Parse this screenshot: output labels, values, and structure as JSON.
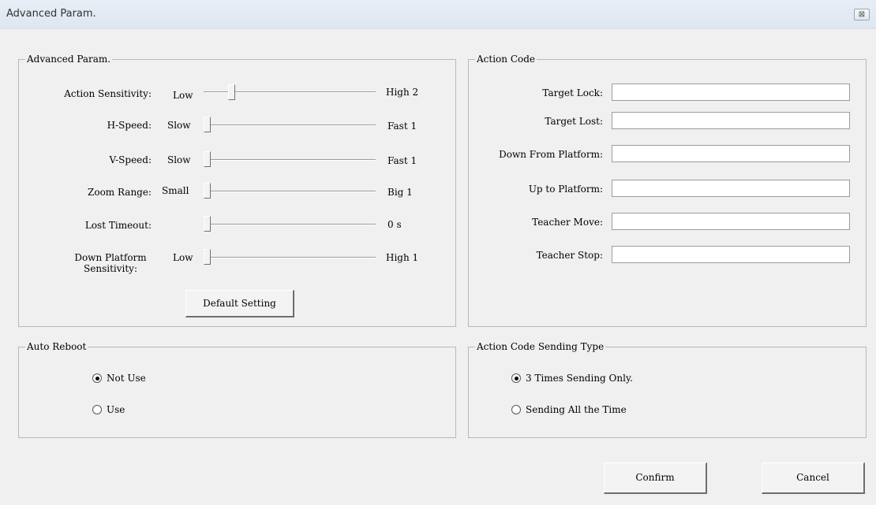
{
  "window": {
    "title": "Advanced Param.",
    "close_glyph": "⊠",
    "close_icon": "close-icon"
  },
  "advanced": {
    "legend": "Advanced Param.",
    "sliders": [
      {
        "label": "Action Sensitivity:",
        "low": "Low",
        "high": "High 2",
        "level": 0.15
      },
      {
        "label": "H-Speed:",
        "low": "Slow",
        "high": "Fast 1",
        "level": 0.0
      },
      {
        "label": "V-Speed:",
        "low": "Slow",
        "high": "Fast 1",
        "level": 0.0
      },
      {
        "label": "Zoom Range:",
        "low": "Small",
        "high": "Big 1",
        "level": 0.0
      },
      {
        "label": "Lost Timeout:",
        "low": "",
        "high": "0 s",
        "level": 0.0
      },
      {
        "label": "Down Platform Sensitivity:",
        "low": "Low",
        "high": "High 1",
        "level": 0.0
      }
    ],
    "default_button": "Default Setting"
  },
  "action_code": {
    "legend": "Action Code",
    "fields": [
      {
        "label": "Target Lock:",
        "value": ""
      },
      {
        "label": "Target Lost:",
        "value": ""
      },
      {
        "label": "Down From Platform:",
        "value": ""
      },
      {
        "label": "Up to Platform:",
        "value": ""
      },
      {
        "label": "Teacher Move:",
        "value": ""
      },
      {
        "label": "Teacher Stop:",
        "value": ""
      }
    ]
  },
  "auto_reboot": {
    "legend": "Auto Reboot",
    "options": [
      {
        "label": "Not Use",
        "checked": true
      },
      {
        "label": "Use",
        "checked": false
      }
    ]
  },
  "sending_type": {
    "legend": "Action Code Sending Type",
    "options": [
      {
        "label": "3 Times Sending Only.",
        "checked": true
      },
      {
        "label": "Sending All the Time",
        "checked": false
      }
    ]
  },
  "buttons": {
    "confirm": "Confirm",
    "cancel": "Cancel"
  }
}
